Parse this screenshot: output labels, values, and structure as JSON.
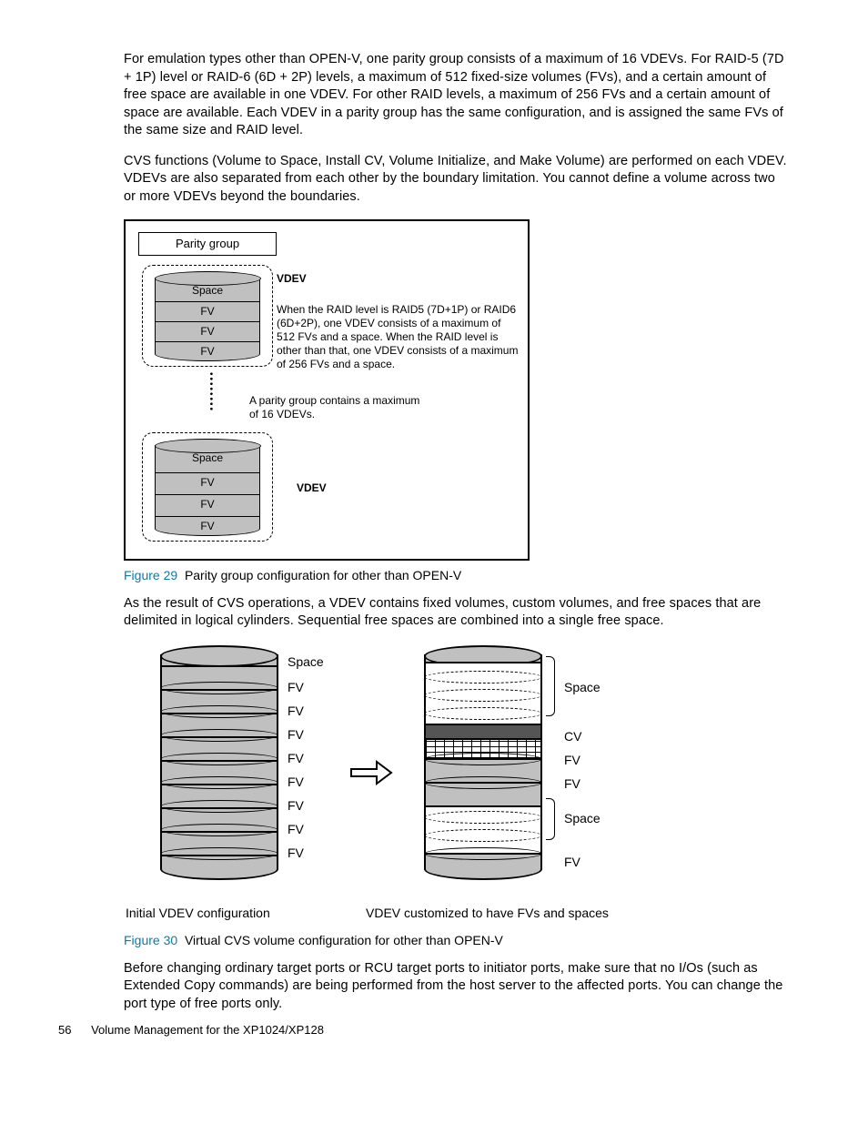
{
  "paragraphs": {
    "p1": "For emulation types other than OPEN-V, one parity group consists of a maximum of 16 VDEVs. For RAID-5 (7D + 1P) level or RAID-6 (6D + 2P) levels, a maximum of 512 fixed-size volumes (FVs), and a certain amount of free space are available in one VDEV. For other RAID levels, a maximum of 256 FVs and a certain amount of space are available. Each VDEV in a parity group has the same configuration, and is assigned the same FVs of the same size and RAID level.",
    "p2": "CVS functions (Volume to Space, Install CV, Volume Initialize, and Make Volume) are performed on each VDEV. VDEVs are also separated from each other by the boundary limitation. You cannot define a volume across two or more VDEVs beyond the boundaries.",
    "p3": "As the result of CVS operations, a VDEV contains fixed volumes, custom volumes, and free spaces that are delimited in logical cylinders. Sequential free spaces are combined into a single free space.",
    "p4": "Before changing ordinary target ports or RCU target ports to initiator ports, make sure that no I/Os (such as Extended Copy commands) are being performed from the host server to the affected ports. You can change the port type of free ports only."
  },
  "fig29": {
    "label": "Figure 29",
    "caption": "Parity group configuration for other than OPEN-V",
    "parity_group": "Parity group",
    "vdev": "VDEV",
    "space": "Space",
    "fv": "FV",
    "desc": "When the RAID level is RAID5 (7D+1P) or RAID6 (6D+2P), one VDEV consists of a maximum of 512 FVs and a space. When the RAID level is other than that, one VDEV consists of a maximum of 256 FVs and a space.",
    "mid": "A parity group contains a maximum of 16 VDEVs."
  },
  "fig30": {
    "label": "Figure 30",
    "caption": "Virtual CVS volume configuration for other than OPEN-V",
    "left": {
      "labels": [
        "Space",
        "FV",
        "FV",
        "FV",
        "FV",
        "FV",
        "FV",
        "FV",
        "FV"
      ],
      "bottom_caption": "Initial VDEV configuration"
    },
    "right": {
      "labels": {
        "space": "Space",
        "cv": "CV",
        "fv": "FV"
      },
      "bottom_caption": "VDEV customized to have FVs and spaces"
    }
  },
  "footer": {
    "page": "56",
    "title": "Volume Management for the XP1024/XP128"
  }
}
